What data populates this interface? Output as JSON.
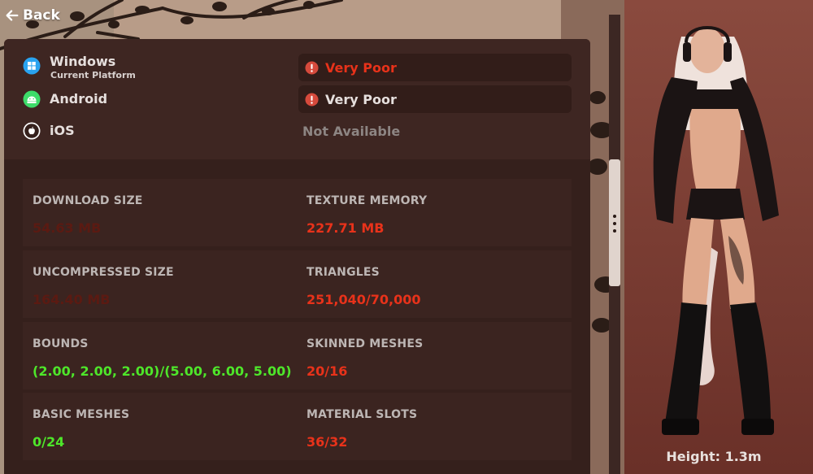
{
  "nav": {
    "back_label": "Back"
  },
  "platforms": [
    {
      "name": "Windows",
      "subtitle": "Current Platform",
      "icon": "windows-icon",
      "rating": "Very Poor",
      "rating_icon": "warning-icon"
    },
    {
      "name": "Android",
      "subtitle": "",
      "icon": "android-icon",
      "rating": "Very Poor",
      "rating_icon": "warning-icon"
    },
    {
      "name": "iOS",
      "subtitle": "",
      "icon": "apple-icon",
      "rating": "Not Available"
    }
  ],
  "stats": [
    {
      "label": "DOWNLOAD SIZE",
      "value": "54.63 MB",
      "status": "dim"
    },
    {
      "label": "TEXTURE MEMORY",
      "value": "227.71 MB",
      "status": "red"
    },
    {
      "label": "UNCOMPRESSED SIZE",
      "value": "164.40 MB",
      "status": "dim"
    },
    {
      "label": "TRIANGLES",
      "value": "251,040/70,000",
      "status": "red"
    },
    {
      "label": "BOUNDS",
      "value": "(2.00, 2.00, 2.00)/(5.00, 6.00, 5.00)",
      "status": "green"
    },
    {
      "label": "SKINNED MESHES",
      "value": "20/16",
      "status": "red"
    },
    {
      "label": "BASIC MESHES",
      "value": "0/24",
      "status": "green"
    },
    {
      "label": "MATERIAL SLOTS",
      "value": "36/32",
      "status": "red"
    }
  ],
  "preview": {
    "height_label": "Height: 1.3m"
  },
  "colors": {
    "panel": "#35201c",
    "card": "#3b2420",
    "very_poor": "#e8321a",
    "good": "#4ee62a",
    "windows_blue": "#29a3f0",
    "android_green": "#3ddc6a"
  }
}
